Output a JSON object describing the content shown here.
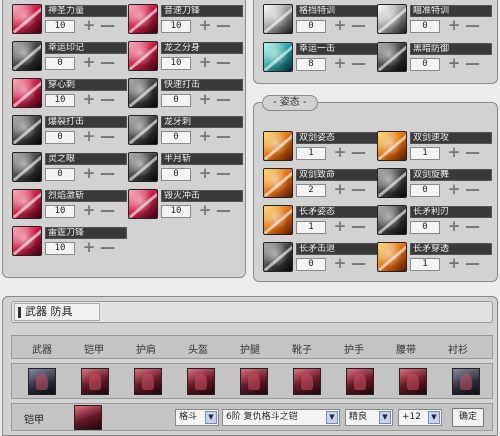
{
  "left_skills": [
    {
      "name": "神圣力量",
      "value": "10",
      "color": "red"
    },
    {
      "name": "音速刀锋",
      "value": "10",
      "color": "red"
    },
    {
      "name": "幸运印记",
      "value": "0",
      "color": "dark"
    },
    {
      "name": "龙之分身",
      "value": "10",
      "color": "red"
    },
    {
      "name": "穿心刺",
      "value": "10",
      "color": "red"
    },
    {
      "name": "快速打击",
      "value": "0",
      "color": "dark"
    },
    {
      "name": "爆裂打击",
      "value": "0",
      "color": "dark"
    },
    {
      "name": "龙牙刺",
      "value": "0",
      "color": "dark"
    },
    {
      "name": "灵之眼",
      "value": "0",
      "color": "dark"
    },
    {
      "name": "半月斩",
      "value": "0",
      "color": "dark"
    },
    {
      "name": "烈焰激斩",
      "value": "10",
      "color": "red"
    },
    {
      "name": "毁灭冲击",
      "value": "10",
      "color": "red"
    },
    {
      "name": "雷霆刀锋",
      "value": "10",
      "color": "red"
    }
  ],
  "right_top_skills": [
    {
      "name": "格挡特训",
      "value": "0",
      "color": "grey"
    },
    {
      "name": "瞄准特训",
      "value": "0",
      "color": "grey"
    },
    {
      "name": "幸运一击",
      "value": "8",
      "color": "teal"
    },
    {
      "name": "黑暗防御",
      "value": "0",
      "color": "dark"
    }
  ],
  "stance": {
    "title": "姿态",
    "skills": [
      {
        "name": "双剑姿态",
        "value": "1",
        "color": "orange"
      },
      {
        "name": "双剑速攻",
        "value": "1",
        "color": "orange"
      },
      {
        "name": "双剑致命",
        "value": "2",
        "color": "orange"
      },
      {
        "name": "双剑旋舞",
        "value": "0",
        "color": "dark"
      },
      {
        "name": "长矛姿态",
        "value": "1",
        "color": "orange"
      },
      {
        "name": "长矛利刃",
        "value": "0",
        "color": "dark"
      },
      {
        "name": "长矛击退",
        "value": "0",
        "color": "dark"
      },
      {
        "name": "长矛穿透",
        "value": "1",
        "color": "orange"
      }
    ]
  },
  "controls": {
    "plus": "+",
    "minus": "—"
  },
  "tabs": {
    "label": "武器 防具"
  },
  "equipment": {
    "headers": [
      "武器",
      "铠甲",
      "护肩",
      "头盔",
      "护腿",
      "靴子",
      "护手",
      "腰带",
      "衬衫"
    ],
    "icons": [
      "weapon",
      "armor",
      "shoulder",
      "helmet",
      "legs",
      "boots",
      "gloves",
      "belt",
      "shirt"
    ]
  },
  "selection": {
    "label": "铠甲",
    "type": "格斗",
    "item": "6阶 复仇格斗之铠",
    "quality": "精良",
    "enhance": "+12",
    "confirm": "确定"
  },
  "dropdown_arrow": "▼"
}
